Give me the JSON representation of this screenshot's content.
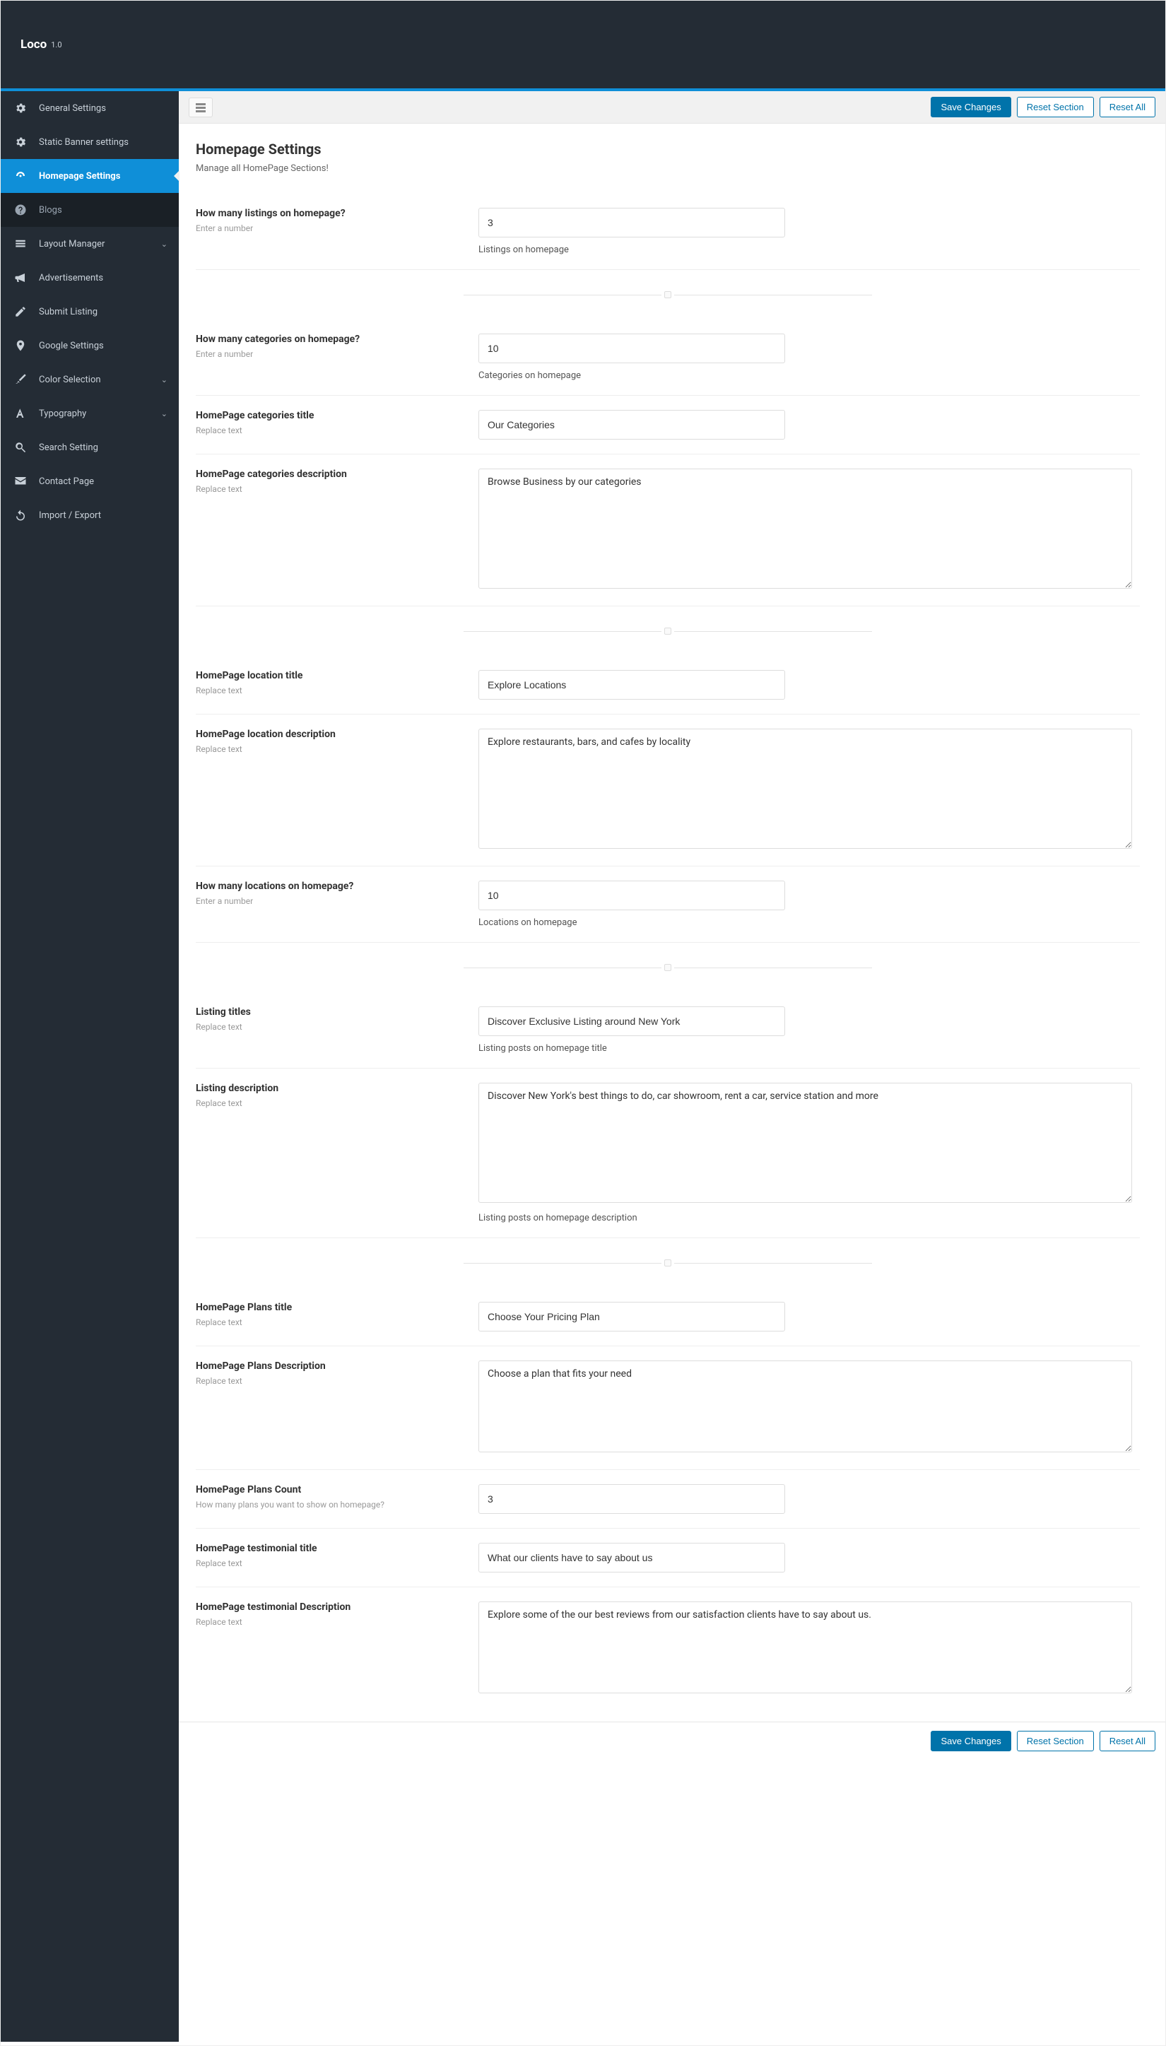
{
  "app": {
    "name": "Loco",
    "version": "1.0"
  },
  "sidebar": {
    "items": [
      {
        "label": "General Settings"
      },
      {
        "label": "Static Banner settings"
      },
      {
        "label": "Homepage Settings"
      },
      {
        "label": "Blogs"
      },
      {
        "label": "Layout Manager"
      },
      {
        "label": "Advertisements"
      },
      {
        "label": "Submit Listing"
      },
      {
        "label": "Google Settings"
      },
      {
        "label": "Color Selection"
      },
      {
        "label": "Typography"
      },
      {
        "label": "Search Setting"
      },
      {
        "label": "Contact Page"
      },
      {
        "label": "Import / Export"
      }
    ]
  },
  "toolbar": {
    "save": "Save Changes",
    "reset_section": "Reset Section",
    "reset_all": "Reset All"
  },
  "page": {
    "title": "Homepage Settings",
    "desc": "Manage all HomePage Sections!"
  },
  "fields": {
    "listings_count": {
      "title": "How many listings on homepage?",
      "sub": "Enter a number",
      "value": "3",
      "help": "Listings on homepage"
    },
    "categories_count": {
      "title": "How many categories on homepage?",
      "sub": "Enter a number",
      "value": "10",
      "help": "Categories on homepage"
    },
    "categories_title": {
      "title": "HomePage categories title",
      "sub": "Replace text",
      "value": "Our Categories"
    },
    "categories_desc": {
      "title": "HomePage categories description",
      "sub": "Replace text",
      "value": "Browse Business by our categories"
    },
    "location_title": {
      "title": "HomePage location title",
      "sub": "Replace text",
      "value": "Explore Locations"
    },
    "location_desc": {
      "title": "HomePage location description",
      "sub": "Replace text",
      "value": "Explore restaurants, bars, and cafes by locality"
    },
    "locations_count": {
      "title": "How many locations on homepage?",
      "sub": "Enter a number",
      "value": "10",
      "help": "Locations on homepage"
    },
    "listing_titles": {
      "title": "Listing titles",
      "sub": "Replace text",
      "value": "Discover Exclusive Listing around New York",
      "help": "Listing posts on homepage title"
    },
    "listing_desc": {
      "title": "Listing description",
      "sub": "Replace text",
      "value": "Discover New York's best things to do, car showroom, rent a car, service station and more",
      "help": "Listing posts on homepage description"
    },
    "plans_title": {
      "title": "HomePage Plans title",
      "sub": "Replace text",
      "value": "Choose Your Pricing Plan"
    },
    "plans_desc": {
      "title": "HomePage Plans Description",
      "sub": "Replace text",
      "value": "Choose a plan that fits your need"
    },
    "plans_count": {
      "title": "HomePage Plans Count",
      "sub": "How many plans you want to show on homepage?",
      "value": "3"
    },
    "testimonial_title": {
      "title": "HomePage testimonial title",
      "sub": "Replace text",
      "value": "What our clients have to say about us"
    },
    "testimonial_desc": {
      "title": "HomePage testimonial Description",
      "sub": "Replace text",
      "value": "Explore some of the our best reviews from our satisfaction clients have to say about us."
    }
  }
}
